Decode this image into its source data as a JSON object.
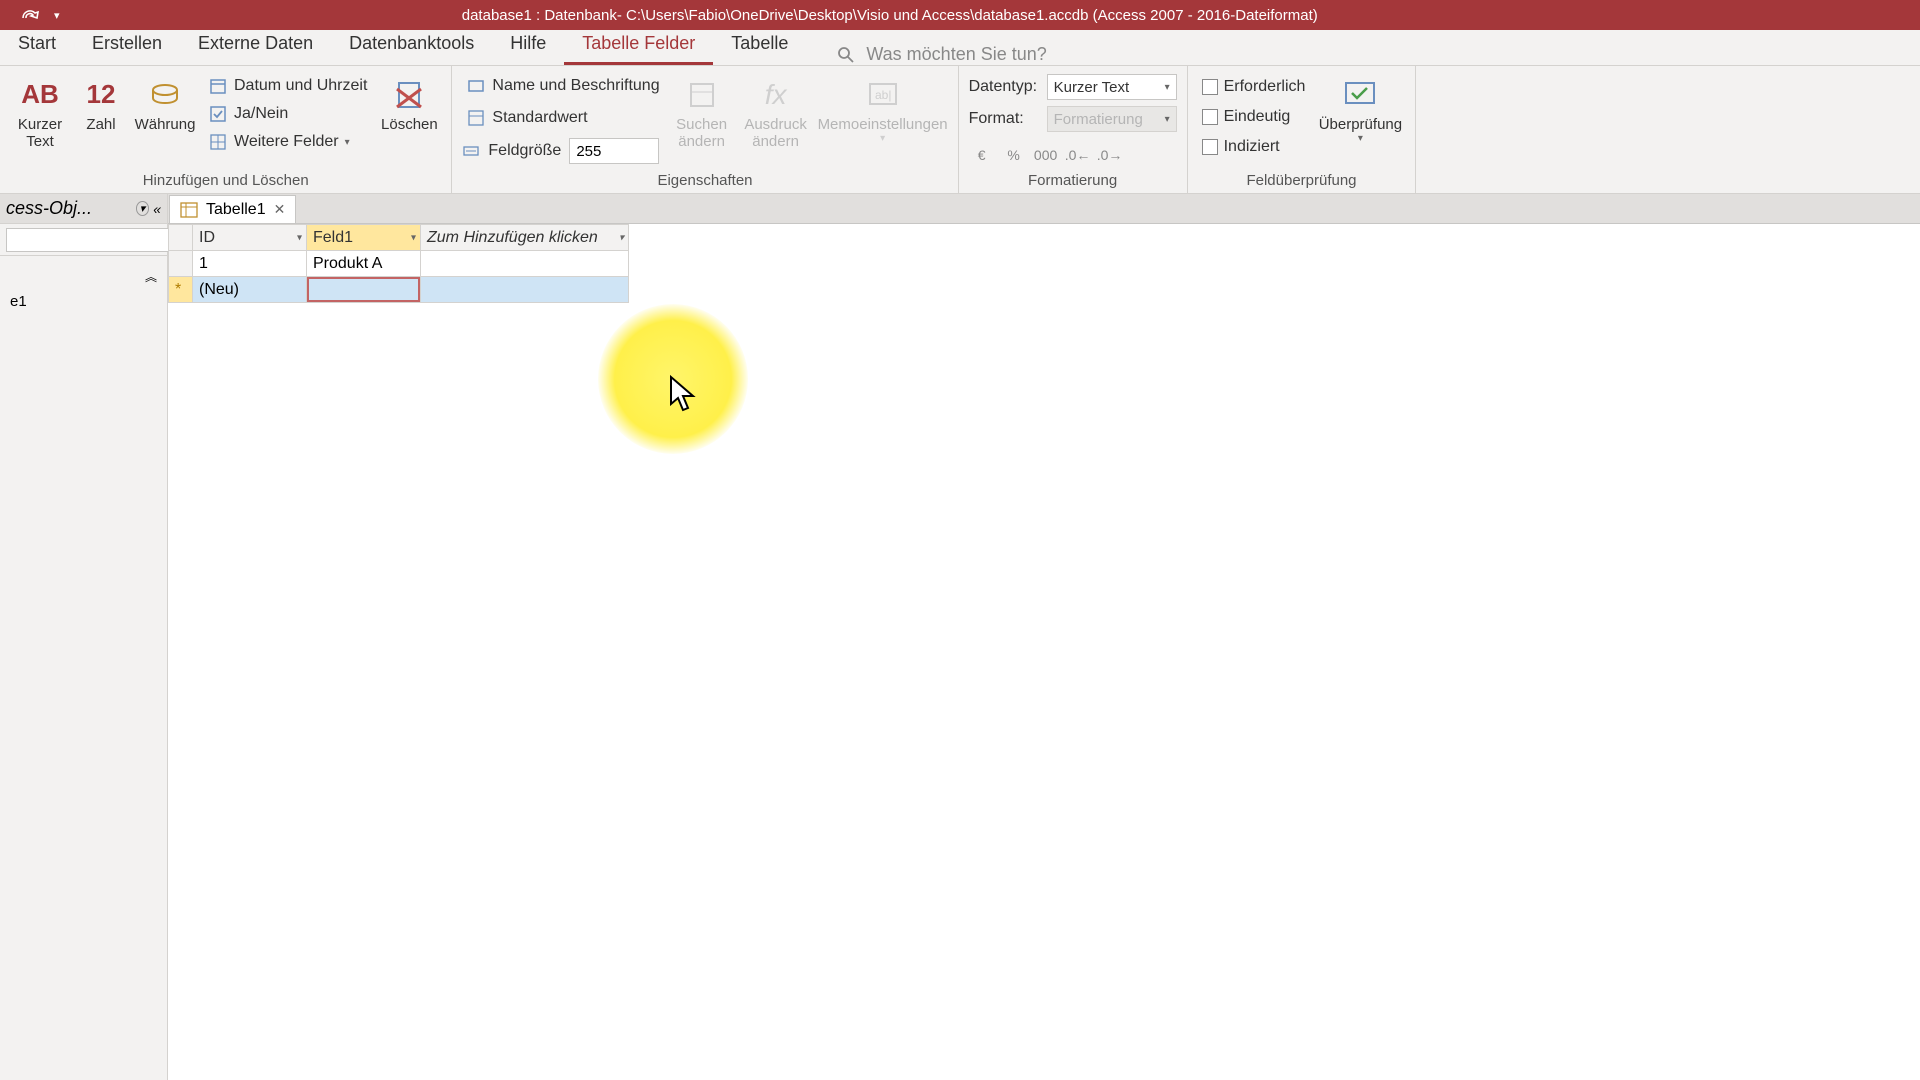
{
  "titlebar": {
    "title": "database1 : Datenbank- C:\\Users\\Fabio\\OneDrive\\Desktop\\Visio und Access\\database1.accdb (Access 2007 - 2016-Dateiformat)"
  },
  "tabs": {
    "start": "Start",
    "erstellen": "Erstellen",
    "externe": "Externe Daten",
    "dbtools": "Datenbanktools",
    "hilfe": "Hilfe",
    "felder": "Tabelle Felder",
    "tabelle": "Tabelle",
    "tellme_placeholder": "Was möchten Sie tun?"
  },
  "ribbon": {
    "add_delete": {
      "kurzer": "Kurzer Text",
      "zahl": "Zahl",
      "waehrung": "Währung",
      "datum": "Datum und Uhrzeit",
      "janein": "Ja/Nein",
      "weitere": "Weitere Felder",
      "loeschen": "Löschen",
      "label": "Hinzufügen und Löschen"
    },
    "props": {
      "name": "Name und Beschriftung",
      "standard": "Standardwert",
      "feldgroesse": "Feldgröße",
      "feldgroesse_val": "255",
      "suchen": "Suchen ändern",
      "ausdruck": "Ausdruck ändern",
      "memo": "Memoeinstellungen",
      "label": "Eigenschaften"
    },
    "fmt": {
      "datentyp": "Datentyp:",
      "datentyp_val": "Kurzer Text",
      "format": "Format:",
      "format_val": "Formatierung",
      "label": "Formatierung"
    },
    "valid": {
      "erforderlich": "Erforderlich",
      "eindeutig": "Eindeutig",
      "indiziert": "Indiziert",
      "ueberpruefung": "Überprüfung",
      "label": "Feldüberprüfung"
    }
  },
  "nav": {
    "title": "cess-Obj...",
    "item": "e1"
  },
  "doc": {
    "tab_name": "Tabelle1",
    "col_id": "ID",
    "col_f1": "Feld1",
    "col_add": "Zum Hinzufügen klicken",
    "row1_id": "1",
    "row1_f1": "Produkt A",
    "new_label": "(Neu)",
    "star": "*"
  }
}
